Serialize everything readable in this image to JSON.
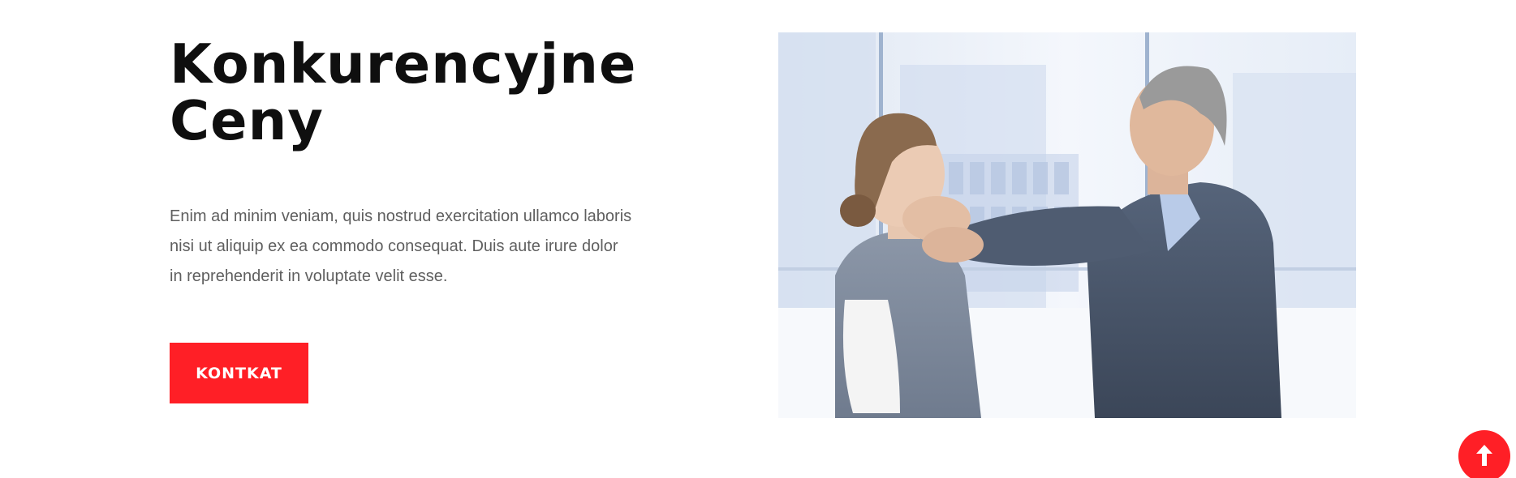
{
  "section": {
    "title_line1": "Konkurencyjne",
    "title_line2": "Ceny",
    "description": "Enim ad minim veniam, quis nostrud exercitation ullamco laboris nisi ut aliquip ex ea commodo consequat. Duis aute irure dolor in reprehenderit in voluptate velit esse.",
    "cta_label": "KONTKAT"
  },
  "image": {
    "alt": "Mężczyzna w garniturze trzymający kobietę za szyję w biurze"
  },
  "scroll_top": {
    "icon": "arrow-up-icon"
  },
  "colors": {
    "accent": "#ff1f26",
    "heading": "#0f0f0f",
    "body_text": "#5f5f5f",
    "background": "#ffffff"
  }
}
